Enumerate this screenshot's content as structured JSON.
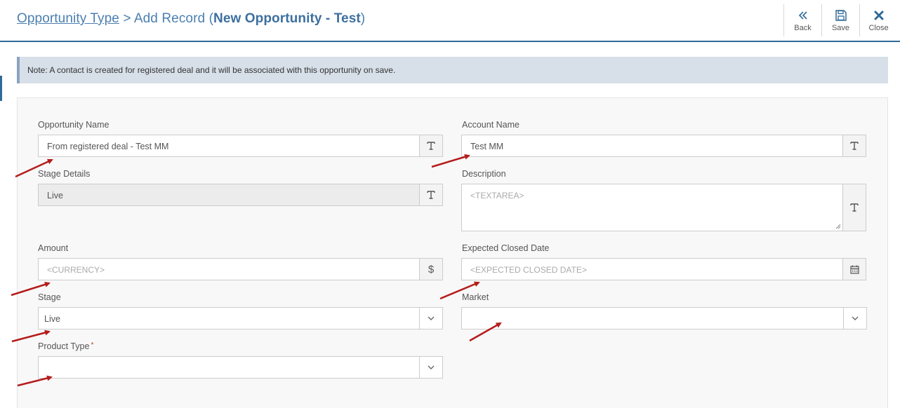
{
  "header": {
    "breadcrumb_link": "Opportunity Type",
    "breadcrumb_sep": " > ",
    "breadcrumb_action": "Add Record (",
    "record_name": "New Opportunity - Test",
    "breadcrumb_close": ")"
  },
  "toolbar": {
    "back_label": "Back",
    "save_label": "Save",
    "close_label": "Close"
  },
  "note": {
    "text": "Note: A contact is created for registered deal and it will be associated with this opportunity on save."
  },
  "form": {
    "opportunity_name": {
      "label": "Opportunity Name",
      "value": "From registered deal - Test MM"
    },
    "account_name": {
      "label": "Account Name",
      "value": "Test MM"
    },
    "stage_details": {
      "label": "Stage Details",
      "value": "Live"
    },
    "description": {
      "label": "Description",
      "placeholder": "<TEXTAREA>"
    },
    "amount": {
      "label": "Amount",
      "placeholder": "<CURRENCY>",
      "addon": "$"
    },
    "expected_closed_date": {
      "label": "Expected Closed Date",
      "placeholder": "<EXPECTED CLOSED DATE>"
    },
    "stage": {
      "label": "Stage",
      "value": "Live"
    },
    "market": {
      "label": "Market",
      "value": ""
    },
    "product_type": {
      "label": "Product Type",
      "required_mark": "*",
      "value": ""
    }
  },
  "colors": {
    "accent": "#2f6a99",
    "title": "#4a7fb0",
    "note_bg": "#d7dfe8",
    "annotation_arrow": "#b51c1c"
  }
}
